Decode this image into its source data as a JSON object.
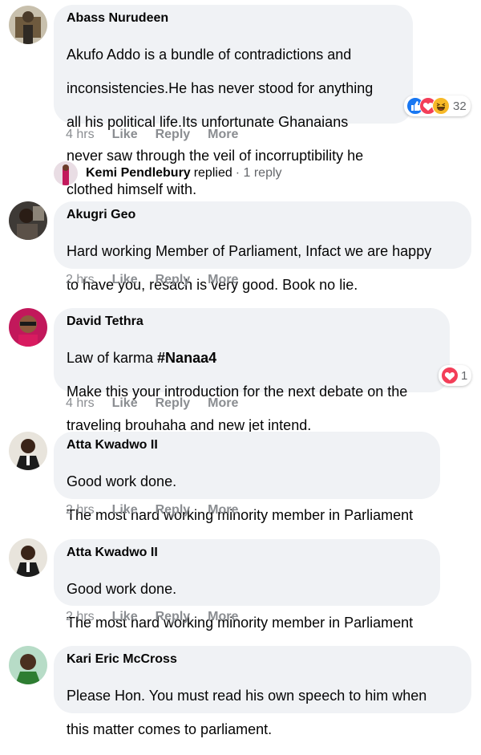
{
  "comments": [
    {
      "author": "Abass Nurudeen",
      "lines": [
        "Akufo Addo is a bundle of contradictions and",
        "inconsistencies.He has never stood for anything",
        "all his political life.Its unfortunate Ghanaians",
        "never saw through the veil of incorruptibility he",
        "clothed himself with."
      ],
      "time": "4 hrs",
      "like": "Like",
      "reply": "Reply",
      "more": "More",
      "reaction_count": "32",
      "reaction_icons": [
        "like-icon",
        "love-icon",
        "haha-icon"
      ]
    },
    {
      "author": "Akugri Geo",
      "lines": [
        "Hard working Member of Parliament, Infact we are happy",
        "to have you, resach is very good. Book no lie."
      ],
      "time": "2 hrs",
      "like": "Like",
      "reply": "Reply",
      "more": "More"
    },
    {
      "author": "David Tethra",
      "line1_prefix": "Law of karma ",
      "hashtag": "#Nanaa4",
      "lines": [
        "Make this your introduction for the next debate on the",
        "traveling brouhaha and new jet intend."
      ],
      "time": "4 hrs",
      "like": "Like",
      "reply": "Reply",
      "more": "More",
      "reaction_count": "1",
      "reaction_icons": [
        "love-icon"
      ]
    },
    {
      "author": "Atta Kwadwo II",
      "lines": [
        "Good work done.",
        "The most hard working minority member in Parliament"
      ],
      "time": "2 hrs",
      "like": "Like",
      "reply": "Reply",
      "more": "More"
    },
    {
      "author": "Atta Kwadwo II",
      "lines": [
        "Good work done.",
        "The most hard working minority member in Parliament"
      ],
      "time": "2 hrs",
      "like": "Like",
      "reply": "Reply",
      "more": "More"
    },
    {
      "author": "Kari Eric McCross",
      "lines": [
        "Please Hon. You must read his own speech to him when",
        "this matter comes to parliament."
      ]
    }
  ],
  "reply_summary": {
    "name": "Kemi Pendlebury",
    "text": "replied",
    "count": "· 1 reply"
  },
  "colors": {
    "bubble": "#f0f2f5",
    "meta": "#8a8d91",
    "like_blue": "#1877f2",
    "love_red": "#f33e58",
    "haha_yellow": "#f7b928"
  }
}
